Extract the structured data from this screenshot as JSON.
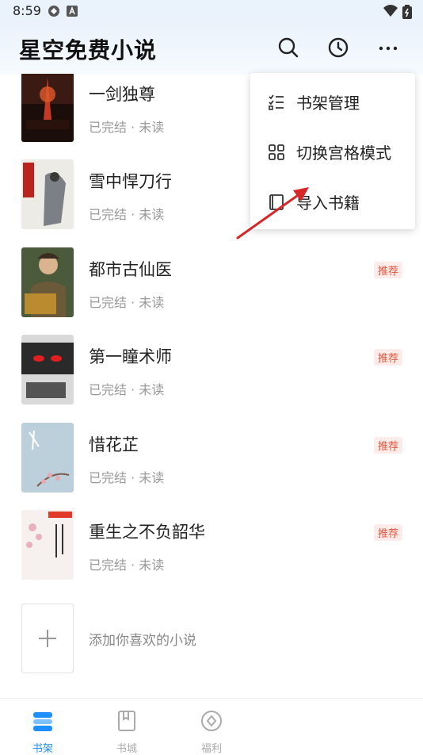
{
  "status_bar": {
    "time": "8:59"
  },
  "header": {
    "title": "星空免费小说"
  },
  "books": [
    {
      "title": "一剑独尊",
      "status": "已完结 · 未读",
      "badge": ""
    },
    {
      "title": "雪中悍刀行",
      "status": "已完结 · 未读",
      "badge": ""
    },
    {
      "title": "都市古仙医",
      "status": "已完结 · 未读",
      "badge": "推荐"
    },
    {
      "title": "第一瞳术师",
      "status": "已完结 · 未读",
      "badge": "推荐"
    },
    {
      "title": "惜花芷",
      "status": "已完结 · 未读",
      "badge": "推荐"
    },
    {
      "title": "重生之不负韶华",
      "status": "已完结 · 未读",
      "badge": "推荐"
    }
  ],
  "add_book": {
    "label": "添加你喜欢的小说"
  },
  "menu": {
    "items": [
      {
        "label": "书架管理",
        "icon": "checklist-icon"
      },
      {
        "label": "切换宫格模式",
        "icon": "grid-icon"
      },
      {
        "label": "导入书籍",
        "icon": "import-book-icon"
      }
    ]
  },
  "tabs": [
    {
      "label": "书架",
      "icon": "bookshelf-icon",
      "active": true
    },
    {
      "label": "书城",
      "icon": "book-store-icon",
      "active": false
    },
    {
      "label": "福利",
      "icon": "welfare-icon",
      "active": false
    }
  ],
  "colors": {
    "accent": "#1e8ffb",
    "badge_text": "#e5533b",
    "badge_bg": "#fdecea",
    "arrow": "#d62828"
  }
}
